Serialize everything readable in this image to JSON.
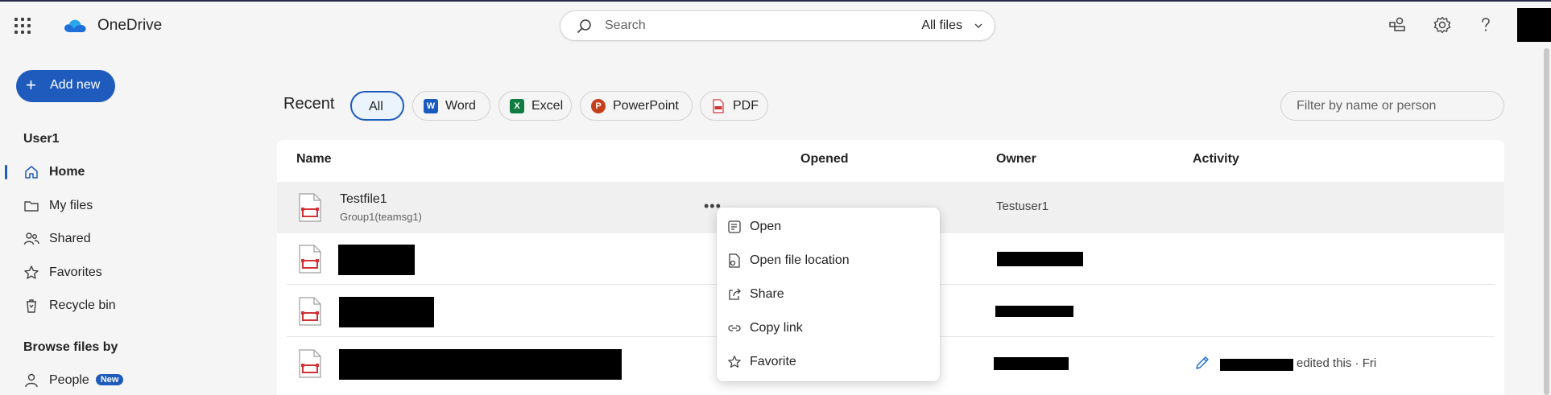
{
  "app": {
    "name": "OneDrive"
  },
  "search": {
    "placeholder": "Search",
    "scope": "All files"
  },
  "sidebar": {
    "add_new": "Add new",
    "user": "User1",
    "items": [
      {
        "label": "Home",
        "icon": "home-icon",
        "active": true
      },
      {
        "label": "My files",
        "icon": "folder-icon"
      },
      {
        "label": "Shared",
        "icon": "people-icon"
      },
      {
        "label": "Favorites",
        "icon": "star-icon"
      },
      {
        "label": "Recycle bin",
        "icon": "trash-icon"
      }
    ],
    "browse_heading": "Browse files by",
    "browse_items": [
      {
        "label": "People",
        "badge": "New",
        "icon": "person-icon"
      }
    ]
  },
  "recent": {
    "title": "Recent",
    "filters": [
      "All",
      "Word",
      "Excel",
      "PowerPoint",
      "PDF"
    ],
    "filter_placeholder": "Filter by name or person"
  },
  "table": {
    "columns": [
      "Name",
      "Opened",
      "Owner",
      "Activity"
    ],
    "rows": [
      {
        "name": "Testfile1",
        "location": "Group1(teamsg1)",
        "owner": "Testuser1",
        "activity": ""
      },
      {
        "name": "",
        "owner": "",
        "activity": ""
      },
      {
        "name": "",
        "owner": "",
        "activity": ""
      },
      {
        "name": "",
        "owner": "",
        "activity": "edited this · Fri"
      }
    ]
  },
  "context_menu": {
    "items": [
      "Open",
      "Open file location",
      "Share",
      "Copy link",
      "Favorite"
    ]
  },
  "colors": {
    "accent": "#1f5bbd",
    "pdf": "#d13438",
    "word": "#185abd",
    "excel": "#107c41",
    "powerpoint": "#c43e1c"
  }
}
